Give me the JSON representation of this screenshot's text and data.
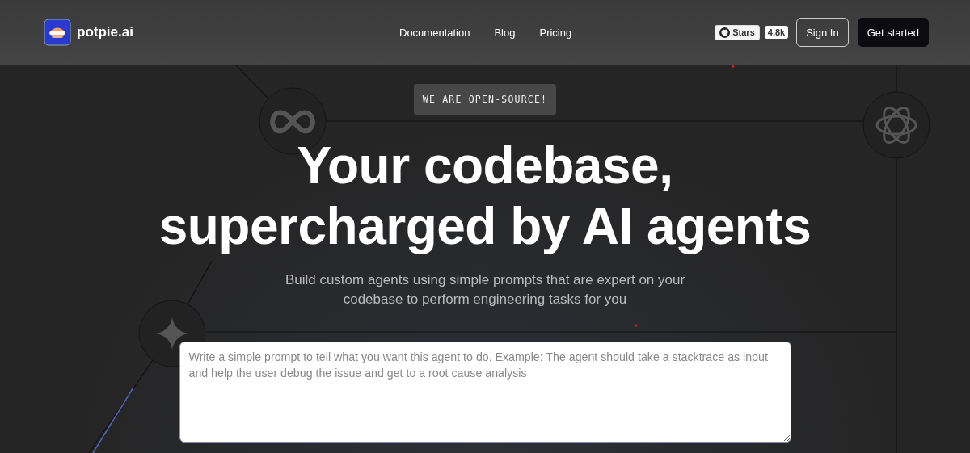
{
  "header": {
    "logo": "potpie.ai",
    "nav": [
      "Documentation",
      "Blog",
      "Pricing"
    ],
    "github": {
      "label": "Stars",
      "count": "4.8k"
    },
    "buttons": [
      {
        "label": "Sign In",
        "kind": "outline"
      },
      {
        "label": "Get started",
        "kind": "solid"
      }
    ]
  },
  "hero": {
    "badge": "WE ARE OPEN-SOURCE!",
    "title": [
      "Your codebase,",
      "supercharged by AI agents"
    ],
    "subtitle": [
      "Build custom agents using simple prompts that are expert on your",
      "codebase to perform engineering tasks for you"
    ],
    "prompt": {
      "placeholder": "Write a simple prompt to tell what you want this agent to do. Example: The agent should take a stacktrace as input and help the user debug the issue and get to a root cause analysis"
    }
  }
}
